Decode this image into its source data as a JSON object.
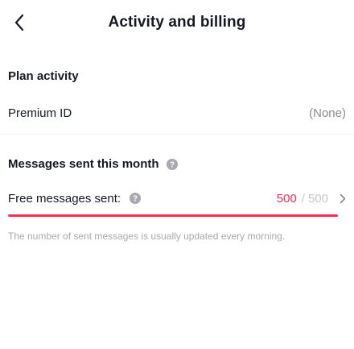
{
  "header": {
    "title": "Activity and billing",
    "back_icon": "chevron-left-icon"
  },
  "plan_activity": {
    "title": "Plan activity",
    "premium_id_label": "Premium ID",
    "premium_id_value": "(None)"
  },
  "messages": {
    "title": "Messages sent this month",
    "title_icon": "help-circle-icon",
    "free_label": "Free messages sent:",
    "used": "500",
    "separator": "/",
    "total": "500",
    "progress_fraction": 1.0,
    "row_icon": "chevron-right-icon",
    "note": "The number of sent messages is usually updated every morning."
  },
  "colors": {
    "accent": "#fe2c55",
    "muted": "#8a8b91",
    "help_icon": "#a8a9b0"
  }
}
